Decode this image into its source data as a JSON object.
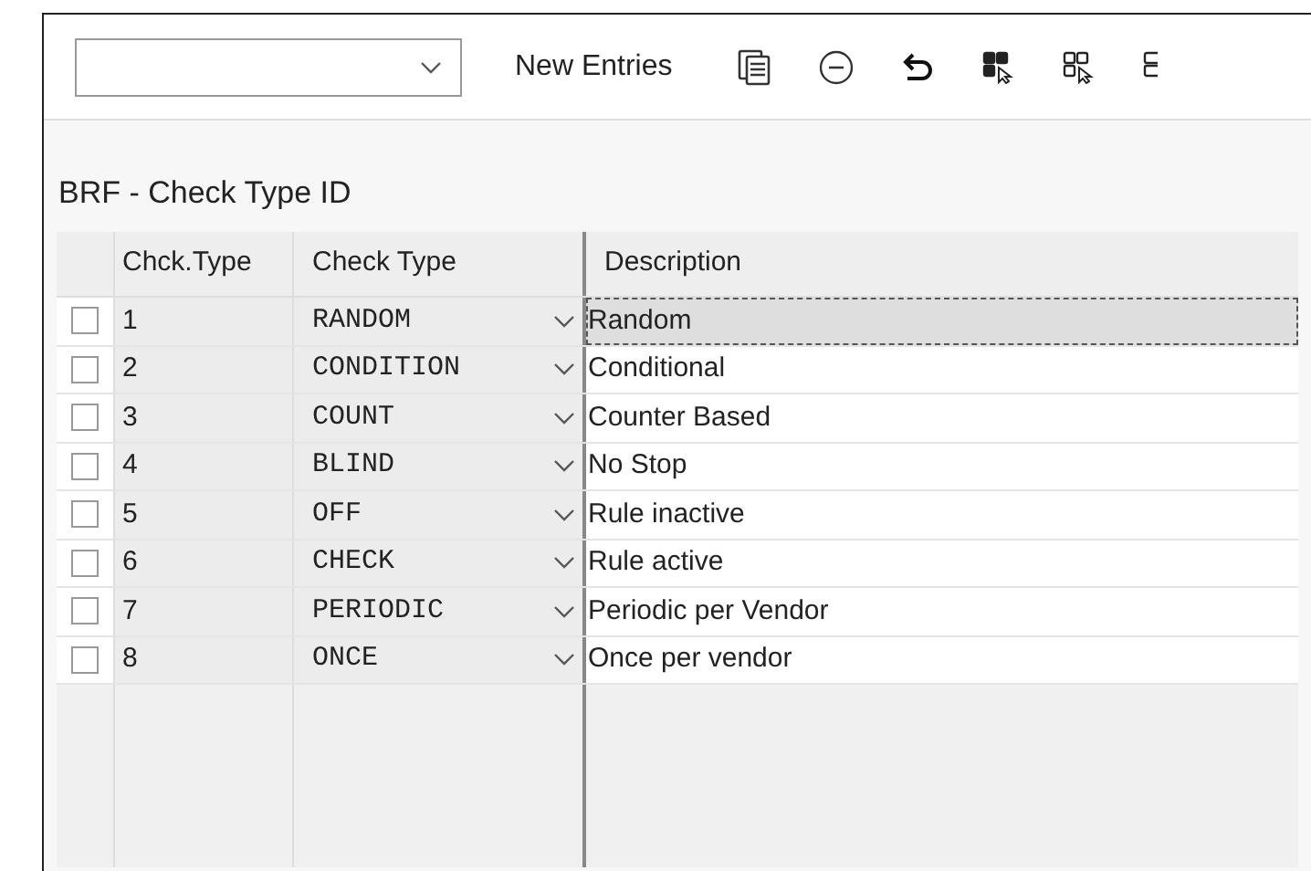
{
  "toolbar": {
    "new_entries": "New Entries"
  },
  "table": {
    "title": "BRF - Check Type ID",
    "columns": [
      "Chck.Type",
      "Check Type",
      "Description"
    ],
    "rows": [
      {
        "checked": false,
        "selected": true,
        "id": "1",
        "check_type": "RANDOM",
        "description": "Random"
      },
      {
        "checked": false,
        "selected": false,
        "id": "2",
        "check_type": "CONDITION",
        "description": "Conditional"
      },
      {
        "checked": false,
        "selected": false,
        "id": "3",
        "check_type": "COUNT",
        "description": "Counter Based"
      },
      {
        "checked": false,
        "selected": false,
        "id": "4",
        "check_type": "BLIND",
        "description": "No Stop"
      },
      {
        "checked": false,
        "selected": false,
        "id": "5",
        "check_type": "OFF",
        "description": "Rule inactive"
      },
      {
        "checked": false,
        "selected": false,
        "id": "6",
        "check_type": "CHECK",
        "description": "Rule active"
      },
      {
        "checked": false,
        "selected": false,
        "id": "7",
        "check_type": "PERIODIC",
        "description": "Periodic per Vendor"
      },
      {
        "checked": false,
        "selected": false,
        "id": "8",
        "check_type": "ONCE",
        "description": "Once per vendor"
      }
    ]
  }
}
